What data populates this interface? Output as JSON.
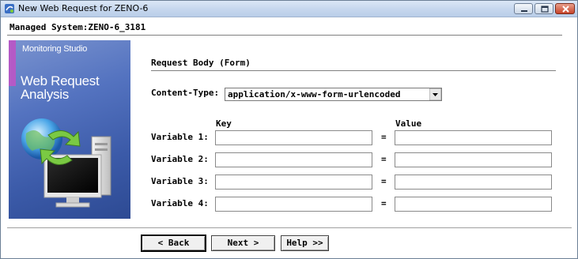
{
  "window": {
    "title": "New Web Request for ZENO-6"
  },
  "header": {
    "managed_system": "Managed System:ZENO-6_3181"
  },
  "banner": {
    "brand": "Monitoring Studio",
    "title_line1": "Web Request",
    "title_line2": "Analysis"
  },
  "form": {
    "section_title": "Request Body (Form)",
    "content_type_label": "Content-Type:",
    "content_type_value": "application/x-www-form-urlencoded",
    "key_header": "Key",
    "value_header": "Value",
    "equals": "=",
    "variables": [
      {
        "label": "Variable 1:",
        "key": "",
        "value": ""
      },
      {
        "label": "Variable 2:",
        "key": "",
        "value": ""
      },
      {
        "label": "Variable 3:",
        "key": "",
        "value": ""
      },
      {
        "label": "Variable 4:",
        "key": "",
        "value": ""
      }
    ]
  },
  "buttons": {
    "back": "< Back",
    "next": "Next >",
    "help": "Help >>"
  }
}
